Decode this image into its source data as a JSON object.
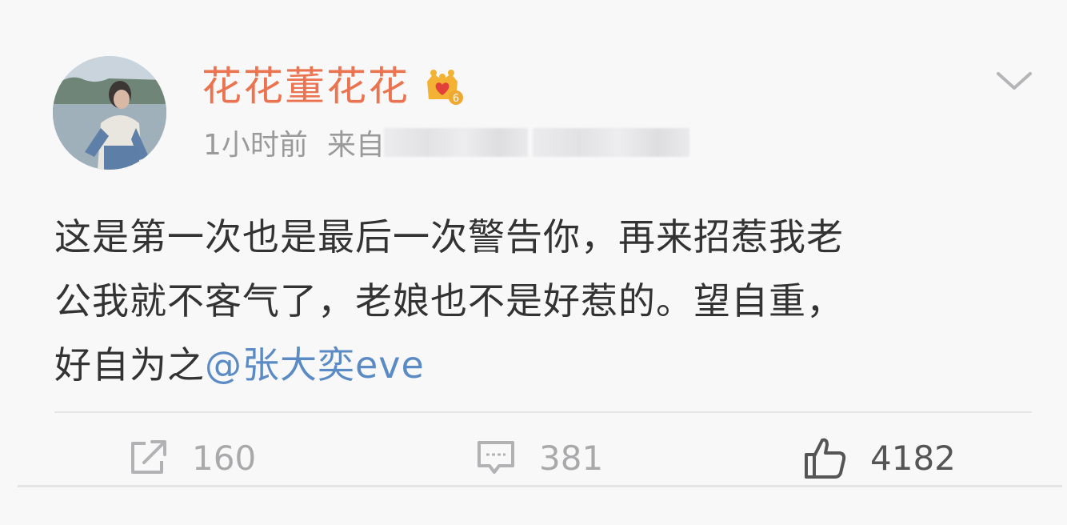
{
  "post": {
    "username": "花花董花花",
    "time": "1小时前",
    "source_prefix": "来自",
    "content_lines": [
      "这是第一次也是最后一次警告你，再来招惹我老",
      "公我就不客气了，老娘也不是好惹的。望自重，",
      "好自为之"
    ],
    "mention": "@张大奕eve",
    "badge_level": "6"
  },
  "actions": {
    "repost_count": "160",
    "comment_count": "381",
    "like_count": "4182"
  },
  "icons": {
    "badge": "vip-crown-icon",
    "menu": "chevron-down-icon",
    "repost": "repost-icon",
    "comment": "comment-icon",
    "like": "thumbs-up-icon"
  },
  "colors": {
    "username": "#eb7350",
    "mention": "#5b8bc4",
    "meta_text": "#9a9a9a",
    "body_text": "#333333"
  }
}
